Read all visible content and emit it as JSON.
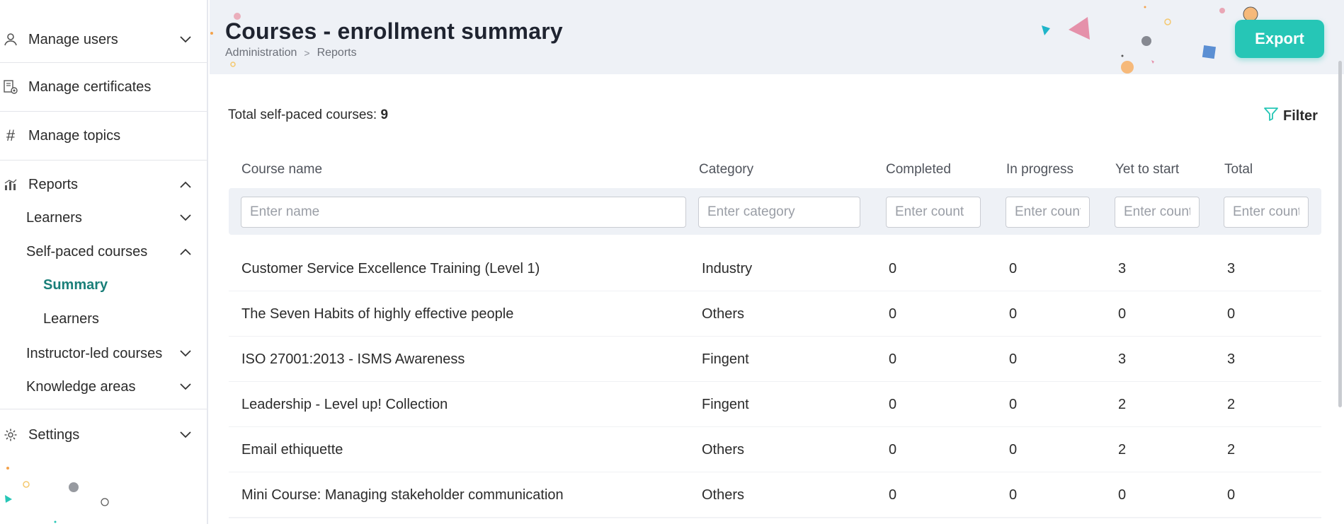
{
  "sidebar": {
    "items": [
      {
        "label": "Manage users",
        "icon": "user-icon"
      },
      {
        "label": "Manage certificates",
        "icon": "certificate-icon"
      },
      {
        "label": "Manage topics",
        "icon": "hash-icon"
      },
      {
        "label": "Reports",
        "icon": "bar-chart-icon"
      },
      {
        "label": "Settings",
        "icon": "gear-icon"
      }
    ],
    "reports_sub": [
      {
        "label": "Learners"
      },
      {
        "label": "Self-paced courses"
      },
      {
        "label": "Instructor-led courses"
      },
      {
        "label": "Knowledge areas"
      }
    ],
    "self_paced_sub": [
      {
        "label": "Summary",
        "active": true
      },
      {
        "label": "Learners"
      }
    ]
  },
  "header": {
    "title": "Courses - enrollment summary",
    "breadcrumb": [
      "Administration",
      "Reports"
    ],
    "export_label": "Export"
  },
  "summary": {
    "total_label": "Total self-paced courses:",
    "total_value": "9",
    "filter_label": "Filter"
  },
  "table": {
    "columns": [
      "Course name",
      "Category",
      "Completed",
      "In progress",
      "Yet to start",
      "Total"
    ],
    "placeholders": [
      "Enter name",
      "Enter category",
      "Enter count",
      "Enter count",
      "Enter count",
      "Enter count"
    ],
    "rows": [
      [
        "Customer Service Excellence Training (Level 1)",
        "Industry",
        "0",
        "0",
        "3",
        "3"
      ],
      [
        "The Seven Habits of highly effective people",
        "Others",
        "0",
        "0",
        "0",
        "0"
      ],
      [
        "ISO 27001:2013 - ISMS Awareness",
        "Fingent",
        "0",
        "0",
        "3",
        "3"
      ],
      [
        "Leadership - Level up! Collection",
        "Fingent",
        "0",
        "0",
        "2",
        "2"
      ],
      [
        "Email ethiquette",
        "Others",
        "0",
        "0",
        "2",
        "2"
      ],
      [
        "Mini Course: Managing stakeholder communication",
        "Others",
        "0",
        "0",
        "0",
        "0"
      ]
    ]
  },
  "colors": {
    "accent": "#26c6b6",
    "active_nav": "#1a7f79",
    "header_bg": "#eef1f6"
  }
}
